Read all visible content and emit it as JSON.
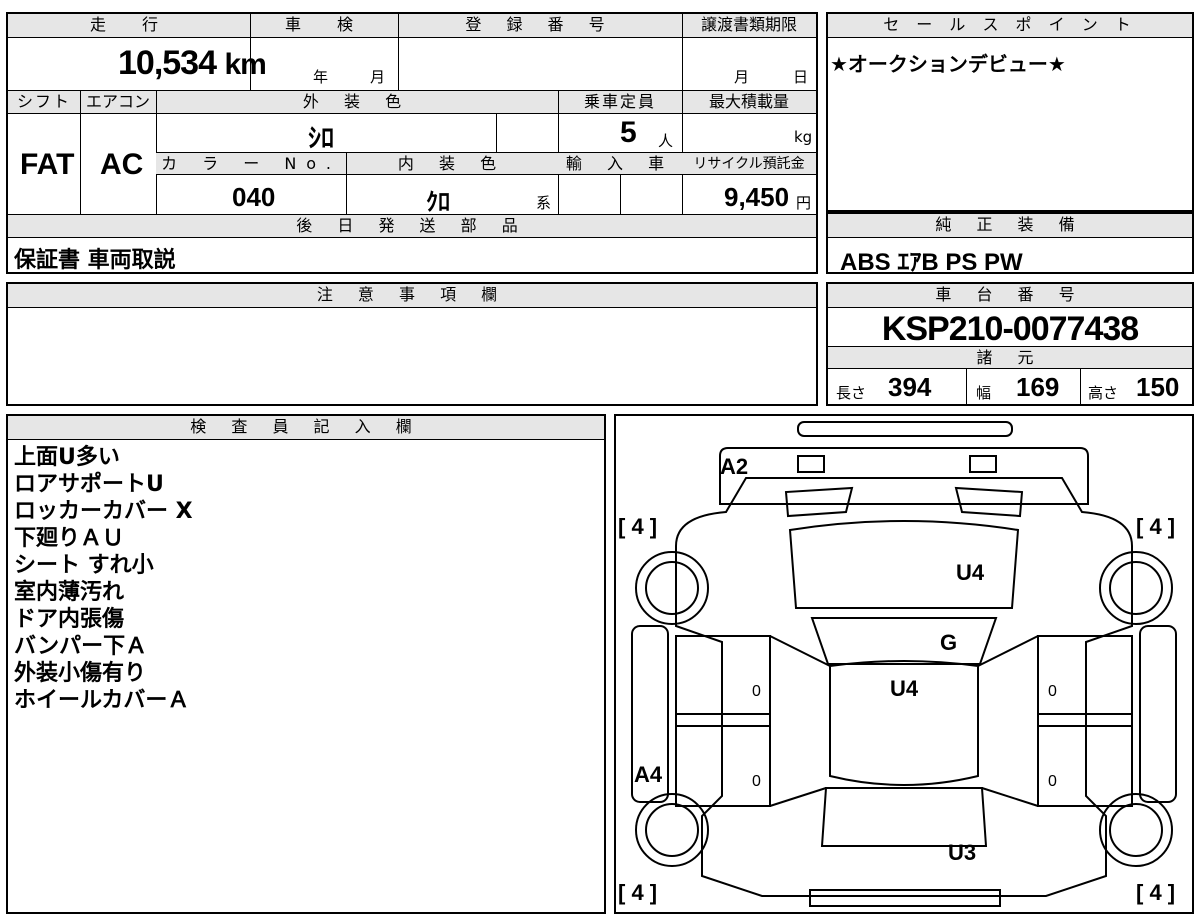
{
  "top_box": {
    "headers": {
      "mileage": "走　行",
      "inspection": "車　検",
      "registration": "登 録 番 号",
      "transfer_deadline": "譲渡書類期限"
    },
    "mileage_value": "10,534",
    "mileage_unit": "km",
    "inspection_year": "年",
    "inspection_month": "月",
    "transfer_month": "月",
    "transfer_day": "日",
    "headers2": {
      "shift": "シフト",
      "aircon": "エアコン",
      "exterior_color": "外 装 色",
      "capacity": "乗車定員",
      "max_load": "最大積載量"
    },
    "shift_value": "FAT",
    "aircon_value": "AC",
    "exterior_color_value": "ｼﾛ",
    "capacity_value": "5",
    "capacity_unit": "人",
    "max_load_unit": "kg",
    "headers3": {
      "color_no": "カ ラ ー No.",
      "interior_color": "内 装 色",
      "import": "輸 入 車",
      "recycle": "リサイクル預託金"
    },
    "color_no_value": "040",
    "interior_color_value": "ｸﾛ",
    "interior_suffix": "系",
    "recycle_value": "9,450",
    "recycle_unit": "円",
    "later_parts_header": "後 日 発 送 部 品",
    "later_parts_value": "保証書 車両取説"
  },
  "sales_point": {
    "header": "セ ー ル ス ポ イ ン ト",
    "text": "★オークションデビュー★"
  },
  "genuine_equipment": {
    "header": "純 正 装 備",
    "text": "ABS ｴｱB PS PW"
  },
  "notes": {
    "header": "注 意 事 項 欄"
  },
  "chassis": {
    "header": "車 台 番 号",
    "value": "KSP210-0077438"
  },
  "specs": {
    "header": "諸 元",
    "length_label": "長さ",
    "length_value": "394",
    "width_label": "幅",
    "width_value": "169",
    "height_label": "高さ",
    "height_value": "150"
  },
  "inspector": {
    "header": "検 査 員 記 入 欄",
    "lines": [
      "上面U多い",
      "ロアサポートU",
      "ロッカーカバー X",
      "下廻りＡＵ",
      "シート すれ小",
      "室内薄汚れ",
      "ドア内張傷",
      "バンパー下Ａ",
      "外装小傷有り",
      "ホイールカバーＡ"
    ]
  },
  "diagram": {
    "labels": {
      "a2": "A2",
      "a4": "A4",
      "u4_hood": "U4",
      "g_glass": "G",
      "u4_roof": "U4",
      "u3_rear": "U3",
      "tire_fl": "[ 4 ]",
      "tire_fr": "[ 4 ]",
      "tire_rl": "[ 4 ]",
      "tire_rr": "[ 4 ]",
      "door_l1": "0",
      "door_l2": "0",
      "door_r1": "0",
      "door_r2": "0"
    }
  }
}
